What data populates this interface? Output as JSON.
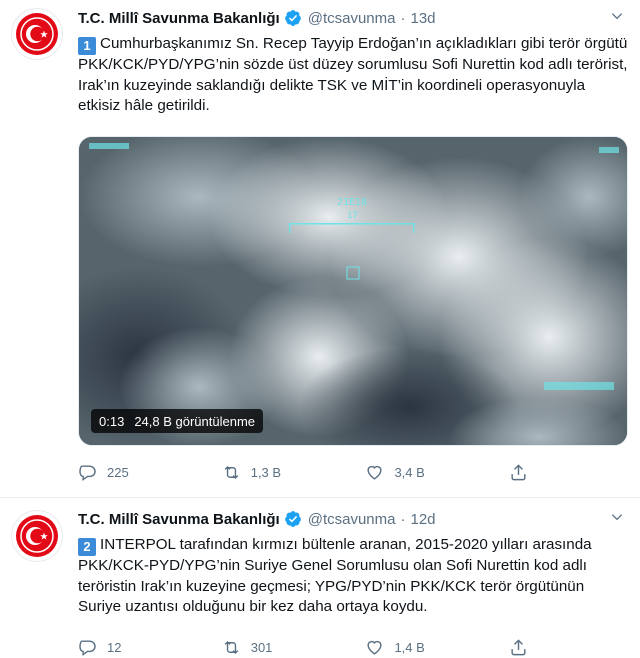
{
  "tweets": [
    {
      "name": "T.C. Millî Savunma Bakanlığı",
      "handle": "@tcsavunma",
      "separator": "·",
      "time": "13d",
      "badge": "1",
      "text": "Cumhurbaşkanımız Sn. Recep Tayyip Erdoğan’ın açıkladıkları gibi terör örgütü PKK/KCK/PYD/YPG’nin sözde üst düzey sorumlusu Sofi Nurettin kod adlı terörist, Irak’ın kuzeyinde saklandığı delikte TSK ve MİT’in koordineli operasyonuyla etkisiz hâle getirildi.",
      "video": {
        "duration": "0:13",
        "views": "24,8 B görüntülenme",
        "overlay_label": "21E18",
        "overlay_sub": "17"
      },
      "replies": "225",
      "retweets": "1,3 B",
      "likes": "3,4 B"
    },
    {
      "name": "T.C. Millî Savunma Bakanlığı",
      "handle": "@tcsavunma",
      "separator": "·",
      "time": "12d",
      "badge": "2",
      "text": "INTERPOL tarafından kırmızı bültenle aranan, 2015-2020 yılları arasında PKK/KCK-PYD/YPG’nin Suriye Genel Sorumlusu olan Sofi Nurettin kod adlı teröristin Irak’ın kuzeyine geçmesi; YPG/PYD’nin PKK/KCK terör örgütünün Suriye uzantısı olduğunu bir kez daha ortaya koydu.",
      "replies": "12",
      "retweets": "301",
      "likes": "1,4 B"
    }
  ],
  "colors": {
    "accent": "#1da1f2",
    "muted": "#5b7083",
    "emblem": "#e30a17",
    "badge": "#3b8bd9"
  }
}
